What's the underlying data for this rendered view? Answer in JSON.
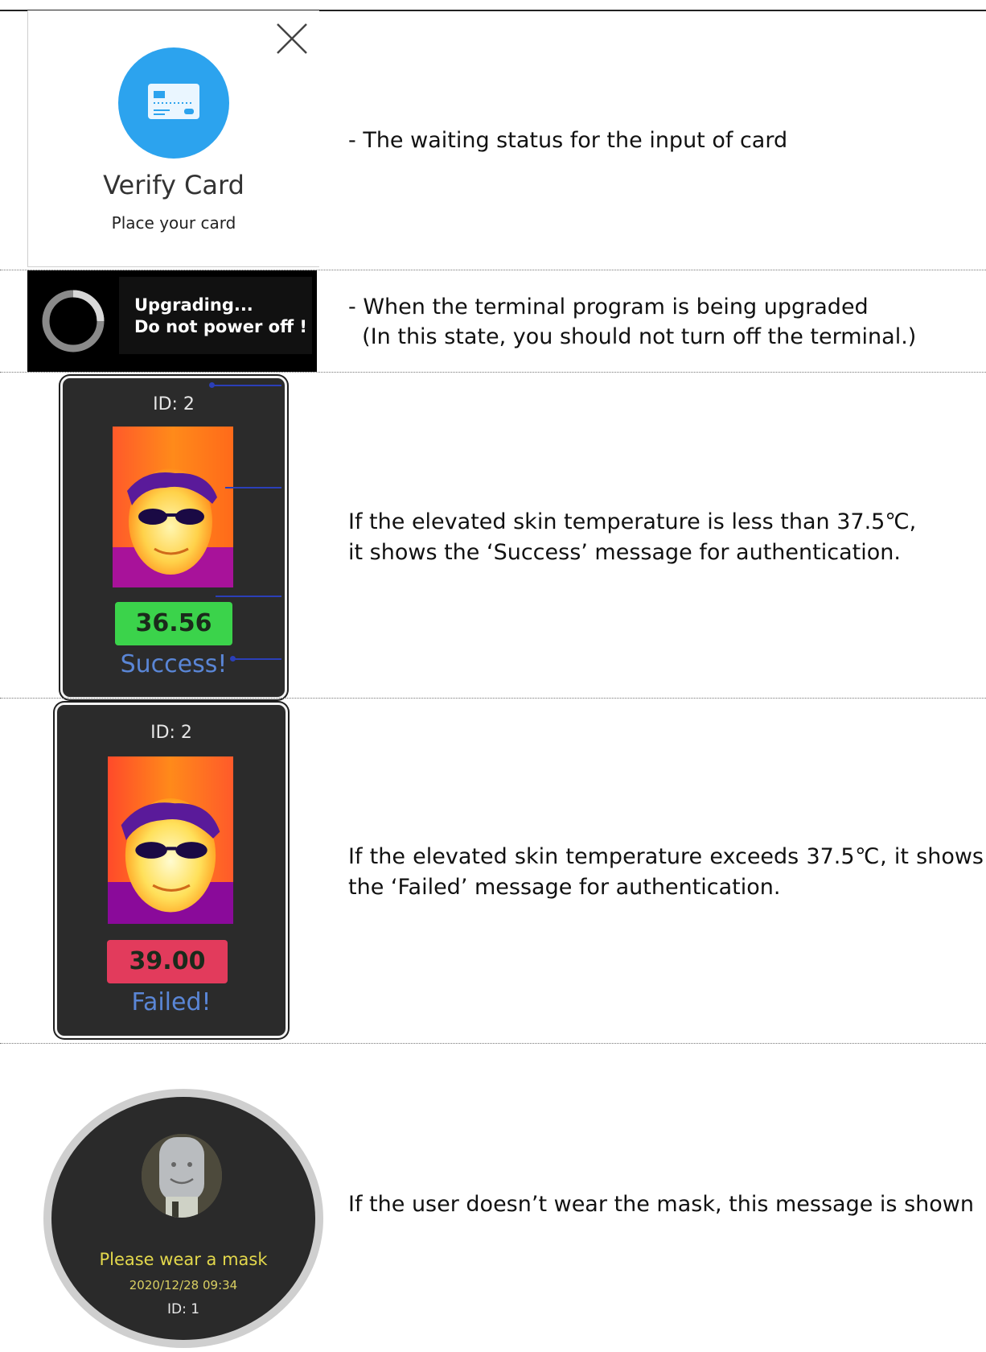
{
  "verify_card": {
    "title": "Verify Card",
    "subtitle": "Place your card",
    "description": "- The waiting status for the input of card",
    "accent": "#2ca3ee"
  },
  "upgrading": {
    "line1": "Upgrading...",
    "line2": "Do not power off !",
    "description_line1": "- When the terminal program is being upgraded",
    "description_line2": "  (In this state, you should not turn off the terminal.)"
  },
  "success": {
    "id": "ID: 2",
    "temperature": "36.56",
    "status": "Success!",
    "badge_color": "#3bd34b",
    "description": "If the elevated skin temperature is less than 37.5℃, it shows the ‘Success’ message for authentication."
  },
  "failed": {
    "id": "ID: 2",
    "temperature": "39.00",
    "status": "Failed!",
    "badge_color": "#e23b5c",
    "description": "If the elevated skin temperature exceeds 37.5℃, it shows the ‘Failed’ message for authentication."
  },
  "mask": {
    "message": "Please wear a mask",
    "datetime": "2020/12/28 09:34",
    "id": "ID: 1",
    "description": "If the user doesn’t wear the mask, this message is shown"
  },
  "icons": [
    "close-icon",
    "card-icon",
    "spinner-icon",
    "thermal-face-image",
    "avatar-icon"
  ]
}
